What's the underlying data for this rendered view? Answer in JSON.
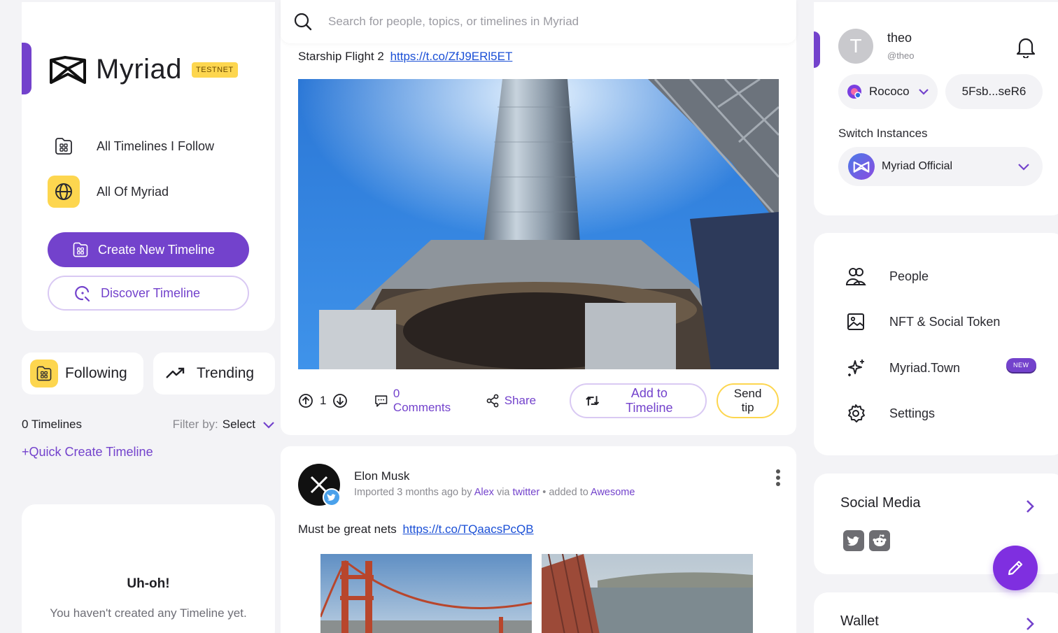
{
  "brand": {
    "name": "Myriad",
    "badge": "TESTNET"
  },
  "left_nav": {
    "items": [
      {
        "label": "All Timelines I Follow",
        "icon": "folder-grid-icon"
      },
      {
        "label": "All Of Myriad",
        "icon": "globe-icon"
      }
    ],
    "create_button": "Create New Timeline",
    "discover_button": "Discover Timeline"
  },
  "tabs": {
    "following": "Following",
    "trending": "Trending"
  },
  "timelines": {
    "count_label": "0 Timelines",
    "filter_label": "Filter by:",
    "filter_value": "Select",
    "quick_create": "+Quick Create Timeline"
  },
  "empty_state": {
    "title": "Uh-oh!",
    "message": "You haven't created any Timeline yet."
  },
  "search": {
    "placeholder": "Search for people, topics, or timelines in Myriad"
  },
  "feed": {
    "post1": {
      "text": "Starship Flight 2",
      "link": "https://t.co/ZfJ9ERl5ET",
      "votes": "1",
      "comments": "0 Comments",
      "share": "Share",
      "add_to_timeline": "Add to Timeline",
      "send_tip": "Send tip"
    },
    "post2": {
      "author": "Elon Musk",
      "meta_imported": "Imported 3 months ago by",
      "meta_user": "Alex",
      "meta_via": "via",
      "meta_source": "twitter",
      "meta_added": "• added to",
      "meta_timeline": "Awesome",
      "text": "Must be great nets",
      "link": "https://t.co/TQaacsPcQB"
    }
  },
  "profile": {
    "avatar_initial": "T",
    "name": "theo",
    "handle": "@theo",
    "network": "Rococo",
    "address": "5Fsb...seR6",
    "switch_label": "Switch Instances",
    "instance": "Myriad Official"
  },
  "right_menu": {
    "items": [
      {
        "label": "People",
        "icon": "people-icon"
      },
      {
        "label": "NFT & Social Token",
        "icon": "image-icon"
      },
      {
        "label": "Myriad.Town",
        "icon": "sparkle-icon",
        "badge": "NEW"
      },
      {
        "label": "Settings",
        "icon": "gear-icon"
      }
    ]
  },
  "social_media": {
    "title": "Social Media"
  },
  "wallet": {
    "title": "Wallet"
  },
  "colors": {
    "accent": "#7342cc",
    "yellow": "#fdd64f",
    "link": "#1a4fd6"
  }
}
